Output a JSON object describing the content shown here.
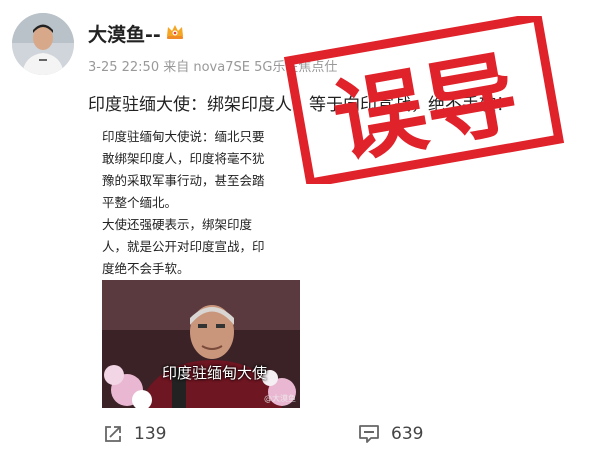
{
  "header": {
    "username": "大漠鱼--",
    "badge_icon": "crown-badge-icon",
    "meta": "3-25 22:50  来自 nova7SE 5G乐在焦点仕"
  },
  "post": {
    "text": "印度驻缅大使：绑架印度人，等于向印宣战，绝不手软！",
    "image": {
      "lines": [
        "印度驻缅甸大使说：缅北只要",
        "敢绑架印度人，印度将毫不犹",
        "豫的采取军事行动，甚至会踏",
        "平整个缅北。",
        "大使还强硬表示，绑架印度",
        "人，就是公开对印度宣战，印",
        "度绝不会手软。"
      ],
      "caption": "印度驻缅甸大使",
      "watermark": "@大漠鱼"
    },
    "stamp_text": "误导",
    "stamp_color": "#e0222a"
  },
  "actions": {
    "share_count": "139",
    "comment_count": "639",
    "share_icon": "share-icon",
    "comment_icon": "comment-icon"
  }
}
